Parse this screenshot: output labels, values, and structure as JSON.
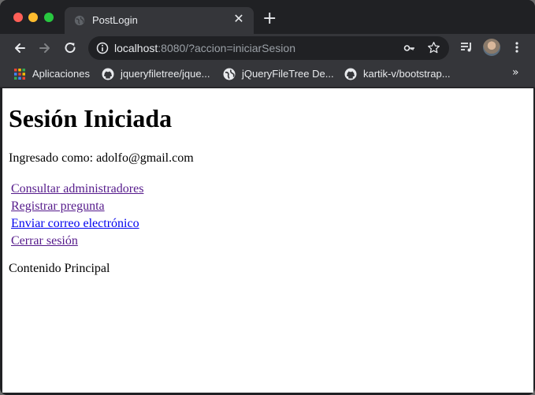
{
  "tab": {
    "title": "PostLogin",
    "close_glyph": "✕"
  },
  "toolbar": {
    "url_host": "localhost",
    "url_rest": ":8080/?accion=iniciarSesion"
  },
  "bookmarks": [
    {
      "label": "Aplicaciones",
      "icon": "apps-grid-icon"
    },
    {
      "label": "jqueryfiletree/jque...",
      "icon": "github-icon"
    },
    {
      "label": "jQueryFileTree De...",
      "icon": "globe-icon"
    },
    {
      "label": "kartik-v/bootstrap...",
      "icon": "github-icon"
    }
  ],
  "page": {
    "heading": "Sesión Iniciada",
    "logged_in_as": "Ingresado como: adolfo@gmail.com",
    "links": [
      {
        "label": "Consultar administradores",
        "visited": true
      },
      {
        "label": "Registrar pregunta",
        "visited": true
      },
      {
        "label": "Enviar correo electrónico",
        "visited": false
      },
      {
        "label": "Cerrar sesión",
        "visited": true
      }
    ],
    "main_content": "Contenido Principal"
  }
}
